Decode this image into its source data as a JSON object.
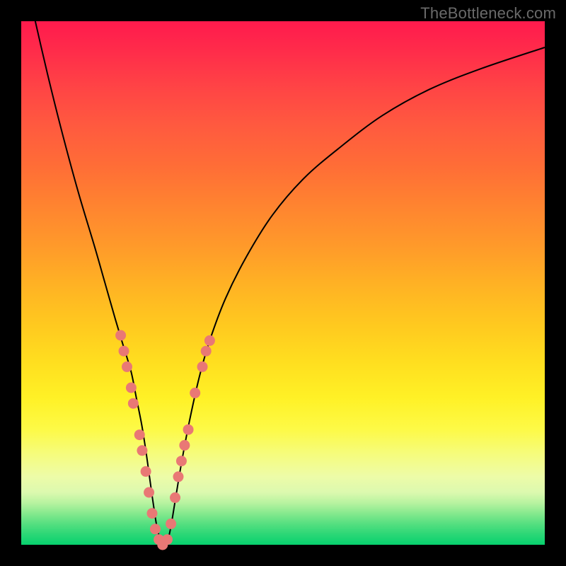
{
  "watermark": "TheBottleneck.com",
  "colors": {
    "marker": "#e97875",
    "curve": "#000000"
  },
  "chart_data": {
    "type": "line",
    "title": "",
    "xlabel": "",
    "ylabel": "",
    "xlim": [
      0,
      100
    ],
    "ylim": [
      0,
      100
    ],
    "grid": false,
    "legend": false,
    "series": [
      {
        "name": "bottleneck-curve",
        "x": [
          2,
          5,
          8,
          11,
          14,
          16,
          18,
          19.5,
          21,
          22,
          23,
          23.8,
          24.5,
          25.2,
          26,
          27,
          27.7,
          28.5,
          29.5,
          30.5,
          32,
          34,
          36,
          39,
          43,
          48,
          54,
          61,
          69,
          78,
          88,
          100
        ],
        "y": [
          103,
          90,
          78,
          67,
          57,
          50,
          43,
          38,
          33,
          28,
          23,
          18,
          13,
          8,
          3,
          0,
          0,
          3,
          9,
          15,
          23,
          32,
          39,
          47,
          55,
          63,
          70,
          76,
          82,
          87,
          91,
          95
        ]
      }
    ],
    "markers": [
      {
        "x": 19.0,
        "y": 40
      },
      {
        "x": 19.6,
        "y": 37
      },
      {
        "x": 20.2,
        "y": 34
      },
      {
        "x": 21.0,
        "y": 30
      },
      {
        "x": 21.4,
        "y": 27
      },
      {
        "x": 22.6,
        "y": 21
      },
      {
        "x": 23.1,
        "y": 18
      },
      {
        "x": 23.8,
        "y": 14
      },
      {
        "x": 24.4,
        "y": 10
      },
      {
        "x": 25.0,
        "y": 6
      },
      {
        "x": 25.6,
        "y": 3
      },
      {
        "x": 26.3,
        "y": 1
      },
      {
        "x": 27.0,
        "y": 0
      },
      {
        "x": 27.9,
        "y": 1
      },
      {
        "x": 28.6,
        "y": 4
      },
      {
        "x": 29.4,
        "y": 9
      },
      {
        "x": 30.0,
        "y": 13
      },
      {
        "x": 30.6,
        "y": 16
      },
      {
        "x": 31.2,
        "y": 19
      },
      {
        "x": 31.9,
        "y": 22
      },
      {
        "x": 33.2,
        "y": 29
      },
      {
        "x": 34.6,
        "y": 34
      },
      {
        "x": 35.3,
        "y": 37
      },
      {
        "x": 36.0,
        "y": 39
      }
    ]
  }
}
